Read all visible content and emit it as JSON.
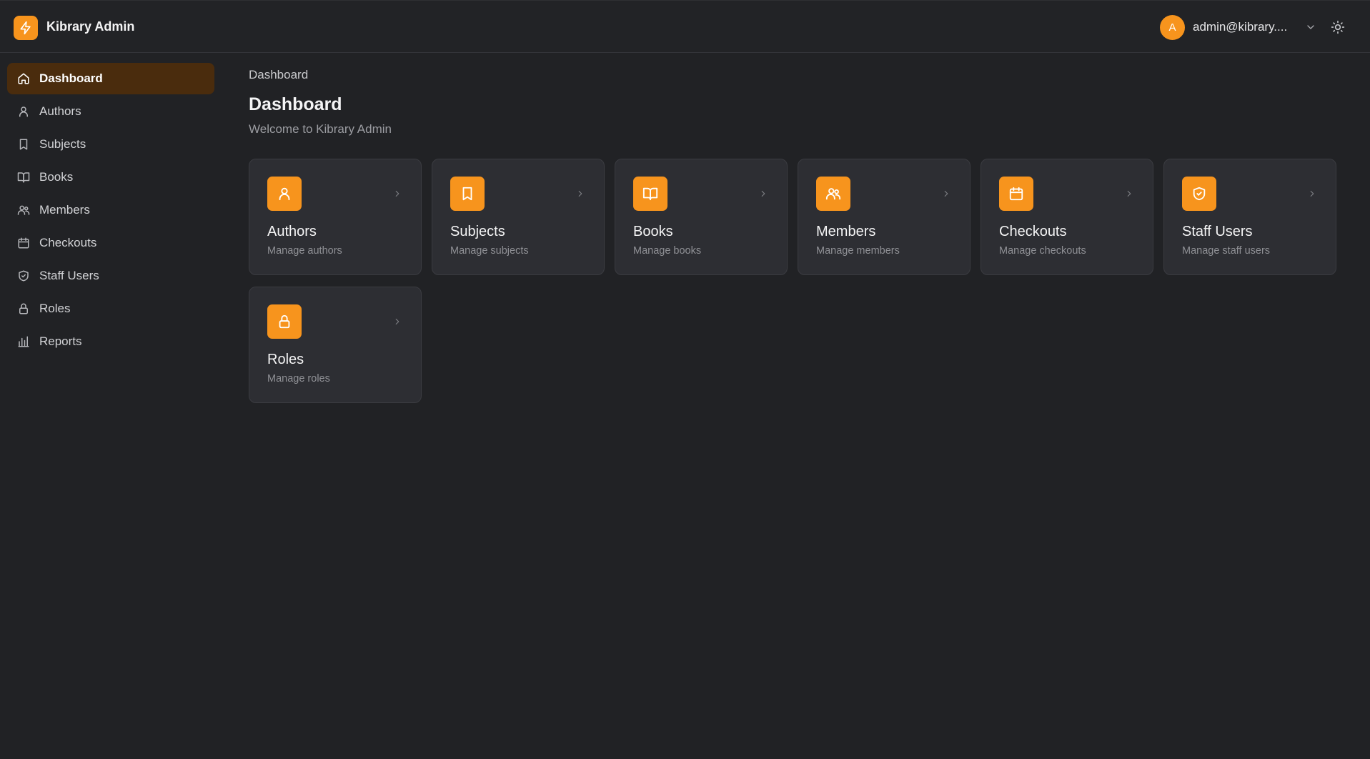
{
  "header": {
    "app_title": "Kibrary Admin",
    "logo_icon": "lightning-icon",
    "user": {
      "avatar_initial": "A",
      "email": "admin@kibrary...."
    },
    "theme_icon": "sun-icon"
  },
  "colors": {
    "accent": "#f7941d",
    "active_nav_bg": "#4a2c0d",
    "background": "#212225",
    "card_bg": "#2d2e33"
  },
  "sidebar": {
    "items": [
      {
        "label": "Dashboard",
        "icon": "home-icon",
        "active": true
      },
      {
        "label": "Authors",
        "icon": "user-icon"
      },
      {
        "label": "Subjects",
        "icon": "bookmark-icon"
      },
      {
        "label": "Books",
        "icon": "book-open-icon"
      },
      {
        "label": "Members",
        "icon": "users-icon"
      },
      {
        "label": "Checkouts",
        "icon": "calendar-icon"
      },
      {
        "label": "Staff Users",
        "icon": "shield-check-icon"
      },
      {
        "label": "Roles",
        "icon": "lock-icon"
      },
      {
        "label": "Reports",
        "icon": "bar-chart-icon"
      }
    ]
  },
  "main": {
    "breadcrumb": "Dashboard",
    "title": "Dashboard",
    "subtitle": "Welcome to Kibrary Admin",
    "cards": [
      {
        "title": "Authors",
        "description": "Manage authors",
        "icon": "user-icon"
      },
      {
        "title": "Subjects",
        "description": "Manage subjects",
        "icon": "bookmark-icon"
      },
      {
        "title": "Books",
        "description": "Manage books",
        "icon": "book-open-icon"
      },
      {
        "title": "Members",
        "description": "Manage members",
        "icon": "users-icon"
      },
      {
        "title": "Checkouts",
        "description": "Manage checkouts",
        "icon": "calendar-icon"
      },
      {
        "title": "Staff Users",
        "description": "Manage staff users",
        "icon": "shield-check-icon"
      },
      {
        "title": "Roles",
        "description": "Manage roles",
        "icon": "lock-icon"
      }
    ]
  }
}
